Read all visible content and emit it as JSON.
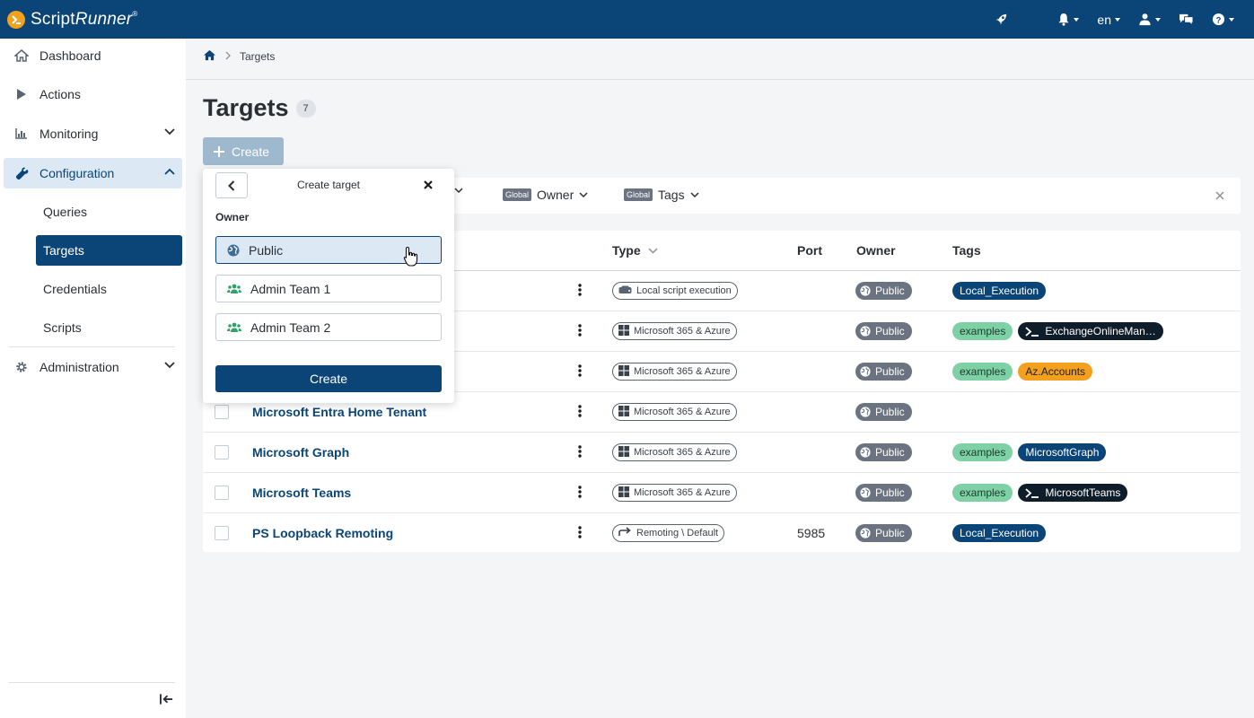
{
  "app": {
    "logo_text": "Script",
    "logo_italic": "Runner",
    "logo_mark": "®"
  },
  "topbar": {
    "language": "en"
  },
  "sidebar": {
    "items": [
      {
        "label": "Dashboard",
        "icon": "home-icon"
      },
      {
        "label": "Actions",
        "icon": "play-icon"
      },
      {
        "label": "Monitoring",
        "icon": "chart-icon"
      },
      {
        "label": "Configuration",
        "icon": "wrench-icon"
      },
      {
        "label": "Administration",
        "icon": "gear-icon"
      }
    ],
    "sub_items": [
      {
        "label": "Queries"
      },
      {
        "label": "Targets"
      },
      {
        "label": "Credentials"
      },
      {
        "label": "Scripts"
      }
    ]
  },
  "breadcrumb": {
    "current": "Targets"
  },
  "page": {
    "title": "Targets",
    "count": "7",
    "create_label": "Create"
  },
  "filters": {
    "global_tag": "Global",
    "owner_label": "Owner",
    "tags_label": "Tags"
  },
  "table": {
    "headers": {
      "type": "Type",
      "port": "Port",
      "owner": "Owner",
      "tags": "Tags"
    },
    "rows": [
      {
        "name": "",
        "type": "Local script execution",
        "type_icon": "drive-icon",
        "port": "",
        "owner": "Public",
        "tags": [
          {
            "label": "Local_Execution",
            "style": "dark"
          }
        ]
      },
      {
        "name": "",
        "type": "Microsoft 365 & Azure",
        "type_icon": "windows-icon",
        "port": "",
        "owner": "Public",
        "tags": [
          {
            "label": "examples",
            "style": "green"
          },
          {
            "label": "ExchangeOnlineMan…",
            "style": "black"
          }
        ]
      },
      {
        "name": "",
        "type": "Microsoft 365 & Azure",
        "type_icon": "windows-icon",
        "port": "",
        "owner": "Public",
        "tags": [
          {
            "label": "examples",
            "style": "green"
          },
          {
            "label": "Az.Accounts",
            "style": "orange"
          }
        ]
      },
      {
        "name": "Microsoft Entra Home Tenant",
        "type": "Microsoft 365 & Azure",
        "type_icon": "windows-icon",
        "port": "",
        "owner": "Public",
        "tags": []
      },
      {
        "name": "Microsoft Graph",
        "type": "Microsoft 365 & Azure",
        "type_icon": "windows-icon",
        "port": "",
        "owner": "Public",
        "tags": [
          {
            "label": "examples",
            "style": "green"
          },
          {
            "label": "MicrosoftGraph",
            "style": "dark"
          }
        ]
      },
      {
        "name": "Microsoft Teams",
        "type": "Microsoft 365 & Azure",
        "type_icon": "windows-icon",
        "port": "",
        "owner": "Public",
        "tags": [
          {
            "label": "examples",
            "style": "green"
          },
          {
            "label": "MicrosoftTeams",
            "style": "black"
          }
        ]
      },
      {
        "name": "PS Loopback Remoting",
        "type": "Remoting \\ Default",
        "type_icon": "arrow-icon",
        "port": "5985",
        "owner": "Public",
        "tags": [
          {
            "label": "Local_Execution",
            "style": "dark"
          }
        ]
      }
    ]
  },
  "popup": {
    "title": "Create target",
    "section_label": "Owner",
    "options": [
      {
        "label": "Public",
        "icon": "globe-icon"
      },
      {
        "label": "Admin Team 1",
        "icon": "group-icon"
      },
      {
        "label": "Admin Team 2",
        "icon": "group-icon"
      }
    ],
    "create_label": "Create"
  },
  "colors": {
    "primary": "#0b4577",
    "accent": "#f2a01d",
    "green": "#7dd1a5"
  }
}
